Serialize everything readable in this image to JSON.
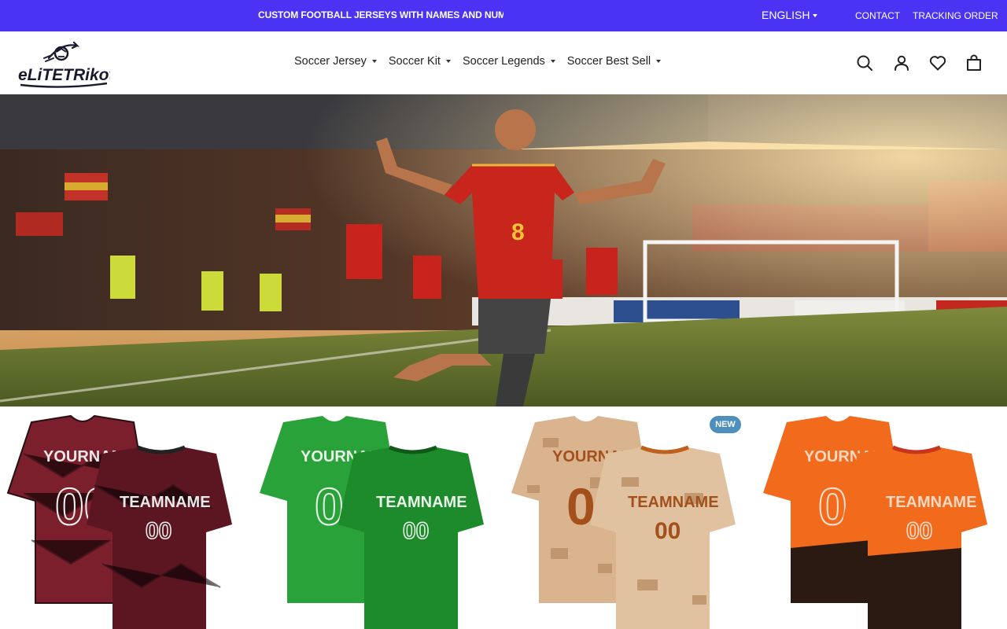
{
  "announcement": {
    "text": "CUSTOM FOOTBALL JERSEYS WITH NAMES AND NUMBERS"
  },
  "topbar": {
    "language": "ENGLISH",
    "links": {
      "contact": "CONTACT",
      "tracking": "TRACKING ORDER"
    },
    "color": "#4a33f2"
  },
  "header": {
    "logo_text": "eLiTETRikot",
    "nav": [
      {
        "label": "Soccer Jersey"
      },
      {
        "label": "Soccer Kit"
      },
      {
        "label": "Soccer Legends"
      },
      {
        "label": "Soccer Best Sell"
      }
    ],
    "icons": [
      "search-icon",
      "account-icon",
      "wishlist-heart-icon",
      "cart-bag-icon"
    ]
  },
  "hero": {
    "image": "soccer-player-celebrating-in-stadium",
    "player_number": "8"
  },
  "products": [
    {
      "colors": [
        "#7a1f2b",
        "#2a0f14"
      ],
      "name_print": "YOURNAME",
      "team_print": "TEAMNAME",
      "number_print": "00",
      "badge": ""
    },
    {
      "colors": [
        "#2aa23a",
        "#1d8a2b"
      ],
      "name_print": "YOURNAME",
      "team_print": "TEAMNAME",
      "number_print": "00",
      "badge": ""
    },
    {
      "colors": [
        "#d9b48e",
        "#b98f66"
      ],
      "name_print": "YOURNAME",
      "team_print": "TEAMNAME",
      "number_print": "00",
      "badge": "NEW"
    },
    {
      "colors": [
        "#f26a1c",
        "#2a1a12"
      ],
      "name_print": "YOURNAME",
      "team_print": "TEAMNAME",
      "number_print": "00",
      "badge": ""
    }
  ]
}
